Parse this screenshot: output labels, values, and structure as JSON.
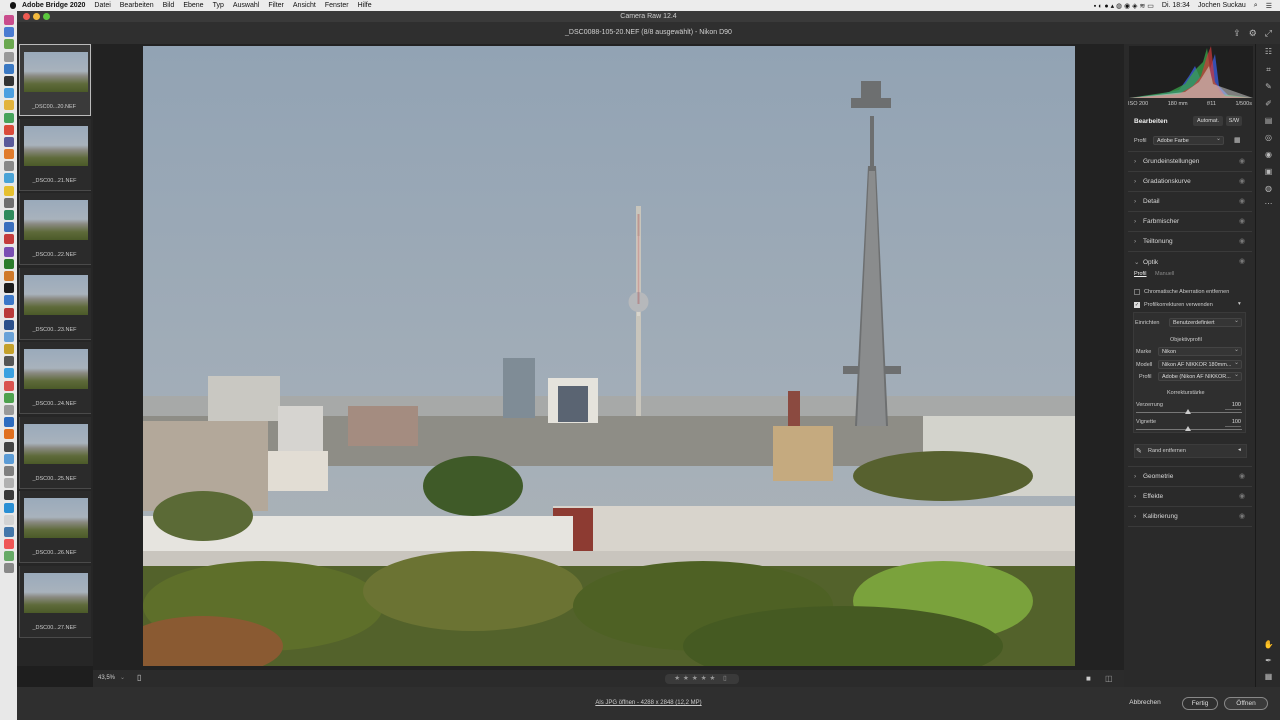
{
  "menubar": {
    "app": "Adobe Bridge 2020",
    "items": [
      "Datei",
      "Bearbeiten",
      "Bild",
      "Ebene",
      "Typ",
      "Auswahl",
      "Filter",
      "Ansicht",
      "Fenster",
      "Hilfe"
    ],
    "clock": "Di. 18:34",
    "user": "Jochen Suckau"
  },
  "window": {
    "title": "Camera Raw 12.4",
    "file_header": "_DSC0088-105-20.NEF (8/8 ausgewählt) - Nikon D90"
  },
  "filmstrip": [
    {
      "label": "_DSC00...20.NEF",
      "selected": true
    },
    {
      "label": "_DSC00...21.NEF",
      "selected": false
    },
    {
      "label": "_DSC00...22.NEF",
      "selected": false
    },
    {
      "label": "_DSC00...23.NEF",
      "selected": false
    },
    {
      "label": "_DSC00...24.NEF",
      "selected": false
    },
    {
      "label": "_DSC00...25.NEF",
      "selected": false
    },
    {
      "label": "_DSC00...26.NEF",
      "selected": false
    },
    {
      "label": "_DSC00...27.NEF",
      "selected": false
    }
  ],
  "meta": {
    "iso": "ISO 200",
    "focal": "180 mm",
    "aperture": "f/11",
    "shutter": "1/500s"
  },
  "edit": {
    "title": "Bearbeiten",
    "auto_label": "Automat.",
    "bw_label": "S/W",
    "profile_label": "Profil",
    "profile_value": "Adobe Farbe"
  },
  "panels": {
    "grund": "Grundeinstellungen",
    "gradation": "Gradationskurve",
    "detail": "Detail",
    "farbmischer": "Farbmischer",
    "teiltonung": "Teiltonung",
    "optik": "Optik",
    "geometrie": "Geometrie",
    "effekte": "Effekte",
    "kalibrierung": "Kalibrierung"
  },
  "optik": {
    "tab_profil": "Profil",
    "tab_manuell": "Manuell",
    "chrom_ab": "Chromatische Aberration entfernen",
    "profilkorrektur": "Profilkorrekturen verwenden",
    "einrichten_label": "Einrichten",
    "einrichten_value": "Benutzerdefiniert",
    "objektivprofil": "Objektivprofil",
    "marke_label": "Marke",
    "marke_value": "Nikon",
    "modell_label": "Modell",
    "modell_value": "Nikon AF NIKKOR 180mm...",
    "profil_label": "Profil",
    "profil_value": "Adobe (Nikon AF NIKKOR...",
    "korrekturstaerke": "Korrekturstärke",
    "verzerrung_label": "Verzerrung",
    "verzerrung_value": "100",
    "vignette_label": "Vignette",
    "vignette_value": "100",
    "rand_entfernen": "Rand entfernen"
  },
  "bottom": {
    "zoom": "43,5%",
    "save_link": "Als JPG öffnen - 4288 x 2848 (12,2 MP)",
    "cancel": "Abbrechen",
    "done": "Fertig",
    "open": "Öffnen"
  }
}
